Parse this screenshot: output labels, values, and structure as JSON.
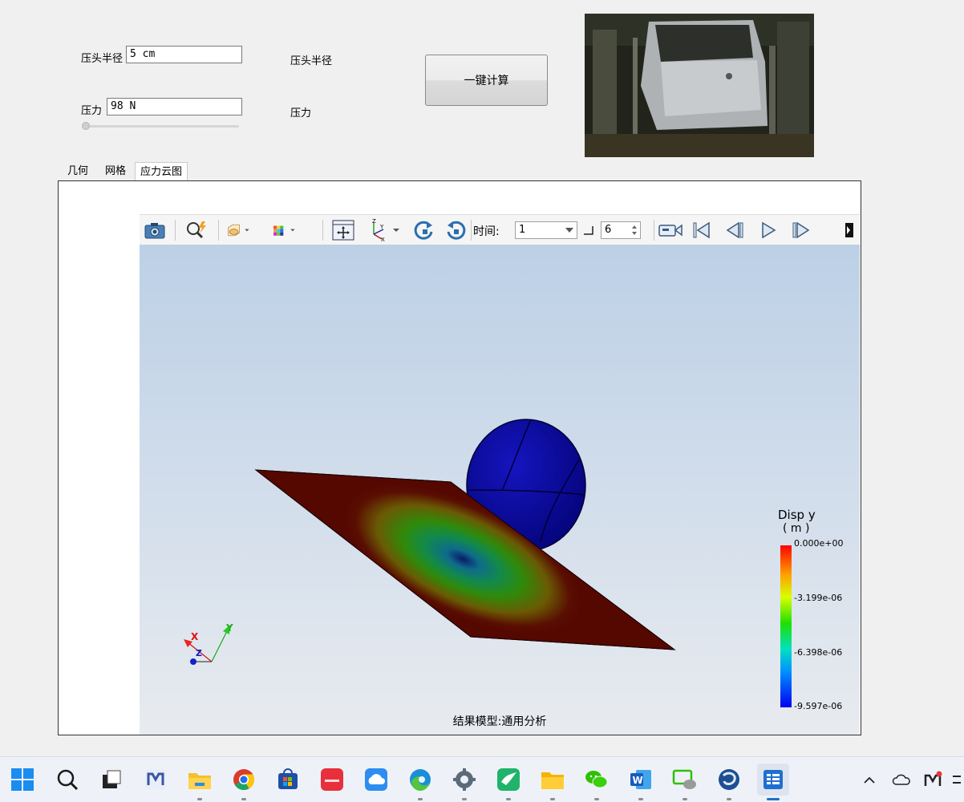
{
  "form": {
    "radius_label": "压头半径",
    "radius_value": "5 cm",
    "radius_readout": "压头半径",
    "force_label": "压力",
    "force_value": "98 N",
    "force_readout": "压力",
    "force_slider_fraction": 0.0,
    "compute_button": "一键计算"
  },
  "tabs": [
    {
      "label": "几何"
    },
    {
      "label": "网格"
    },
    {
      "label": "应力云图",
      "active": true
    }
  ],
  "toolbar": {
    "time_label": "时间:",
    "time_value": "1",
    "step_value": "6",
    "icons": [
      "camera-icon",
      "zoom-icon",
      "section-cube-icon",
      "color-cube-icon",
      "fit-view-icon",
      "axes-icon",
      "rotate-cw-icon",
      "rotate-ccw-icon",
      "video-icon",
      "first-frame-icon",
      "prev-frame-icon",
      "play-icon",
      "next-frame-icon",
      "expand-icon"
    ]
  },
  "viewer": {
    "caption": "结果模型:通用分析",
    "triad": {
      "x": "X",
      "y": "Y",
      "z": "Z"
    },
    "legend": {
      "title": "Disp y",
      "unit": "( m )",
      "ticks": [
        "0.000e+00",
        "-3.199e-06",
        "-6.398e-06",
        "-9.597e-06"
      ]
    }
  },
  "taskbar": {
    "icons": [
      "start-icon",
      "search-icon",
      "task-view-icon",
      "mindmaster-icon",
      "file-explorer-icon",
      "chrome-icon",
      "store-icon",
      "huawei-appgallery-icon",
      "cloud-drive-icon",
      "edge-icon",
      "settings-icon",
      "swift-app-icon",
      "folder-icon",
      "wechat-icon",
      "word-icon",
      "wechat-remote-icon",
      "app-swirl-icon",
      "active-app-icon"
    ],
    "tray": [
      "chevron-up-icon",
      "onedrive-icon",
      "mindmaster-tray-icon",
      "overflow-icon"
    ]
  }
}
